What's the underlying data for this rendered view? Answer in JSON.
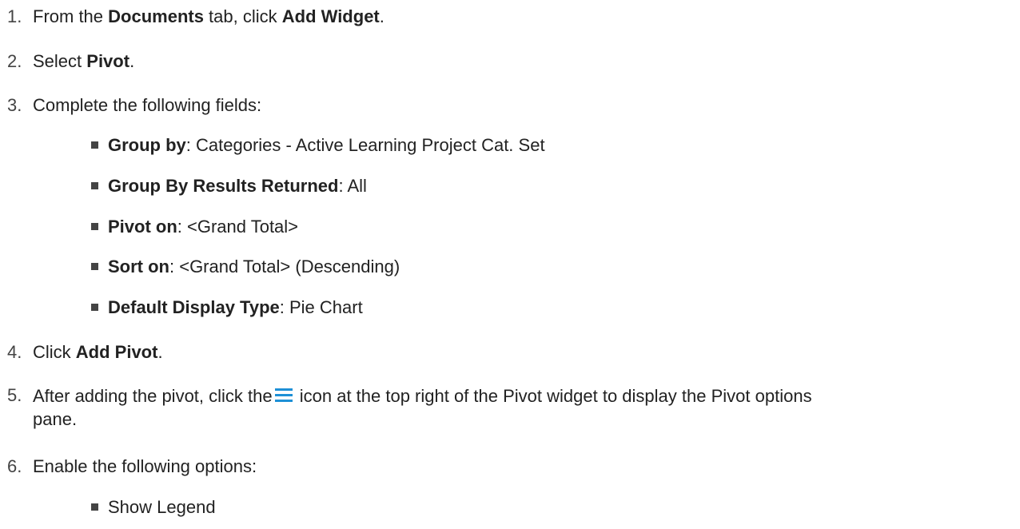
{
  "steps": [
    {
      "num": "1.",
      "pre": "From the ",
      "b1": "Documents",
      "mid": " tab, click ",
      "b2": "Add Widget",
      "post": "."
    },
    {
      "num": "2.",
      "pre": "Select ",
      "b1": "Pivot",
      "post": "."
    },
    {
      "num": "3.",
      "text": "Complete the following fields:"
    },
    {
      "num": "4.",
      "pre": "Click ",
      "b1": "Add Pivot",
      "post": "."
    },
    {
      "num": "5.",
      "pre": "After adding the pivot, click the",
      "post": " icon at the top right of the Pivot widget to display the Pivot options",
      "post2": "pane."
    },
    {
      "num": "6.",
      "text": "Enable the following options:"
    }
  ],
  "fields": [
    {
      "label": "Group by",
      "value": ": Categories - Active Learning Project Cat. Set"
    },
    {
      "label": "Group By Results Returned",
      "value": ": All"
    },
    {
      "label": "Pivot on",
      "value": ": <Grand Total>"
    },
    {
      "label": "Sort on",
      "value": ": <Grand Total> (Descending)"
    },
    {
      "label": "Default Display Type",
      "value": ": Pie Chart"
    }
  ],
  "options": [
    {
      "label": "Show Legend"
    }
  ],
  "icons": {
    "menu": "hamburger-menu-icon",
    "menu_color": "#1e90d6"
  }
}
